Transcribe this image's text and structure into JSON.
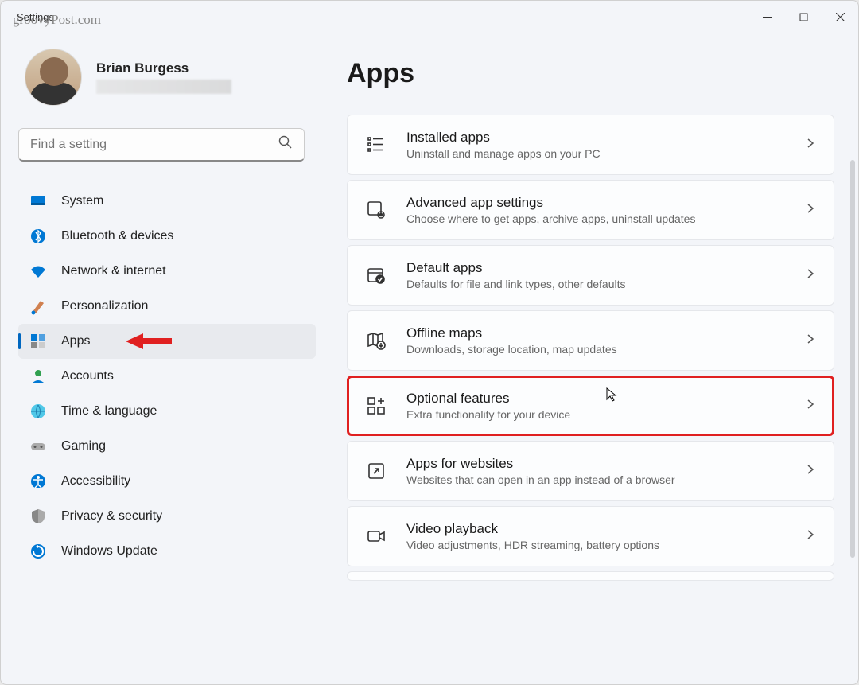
{
  "watermark": "groovyPost.com",
  "window_title": "Settings",
  "profile": {
    "name": "Brian Burgess"
  },
  "search": {
    "placeholder": "Find a setting"
  },
  "nav": {
    "items": [
      {
        "label": "System"
      },
      {
        "label": "Bluetooth & devices"
      },
      {
        "label": "Network & internet"
      },
      {
        "label": "Personalization"
      },
      {
        "label": "Apps"
      },
      {
        "label": "Accounts"
      },
      {
        "label": "Time & language"
      },
      {
        "label": "Gaming"
      },
      {
        "label": "Accessibility"
      },
      {
        "label": "Privacy & security"
      },
      {
        "label": "Windows Update"
      }
    ]
  },
  "page": {
    "title": "Apps"
  },
  "cards": [
    {
      "title": "Installed apps",
      "sub": "Uninstall and manage apps on your PC"
    },
    {
      "title": "Advanced app settings",
      "sub": "Choose where to get apps, archive apps, uninstall updates"
    },
    {
      "title": "Default apps",
      "sub": "Defaults for file and link types, other defaults"
    },
    {
      "title": "Offline maps",
      "sub": "Downloads, storage location, map updates"
    },
    {
      "title": "Optional features",
      "sub": "Extra functionality for your device"
    },
    {
      "title": "Apps for websites",
      "sub": "Websites that can open in an app instead of a browser"
    },
    {
      "title": "Video playback",
      "sub": "Video adjustments, HDR streaming, battery options"
    }
  ]
}
